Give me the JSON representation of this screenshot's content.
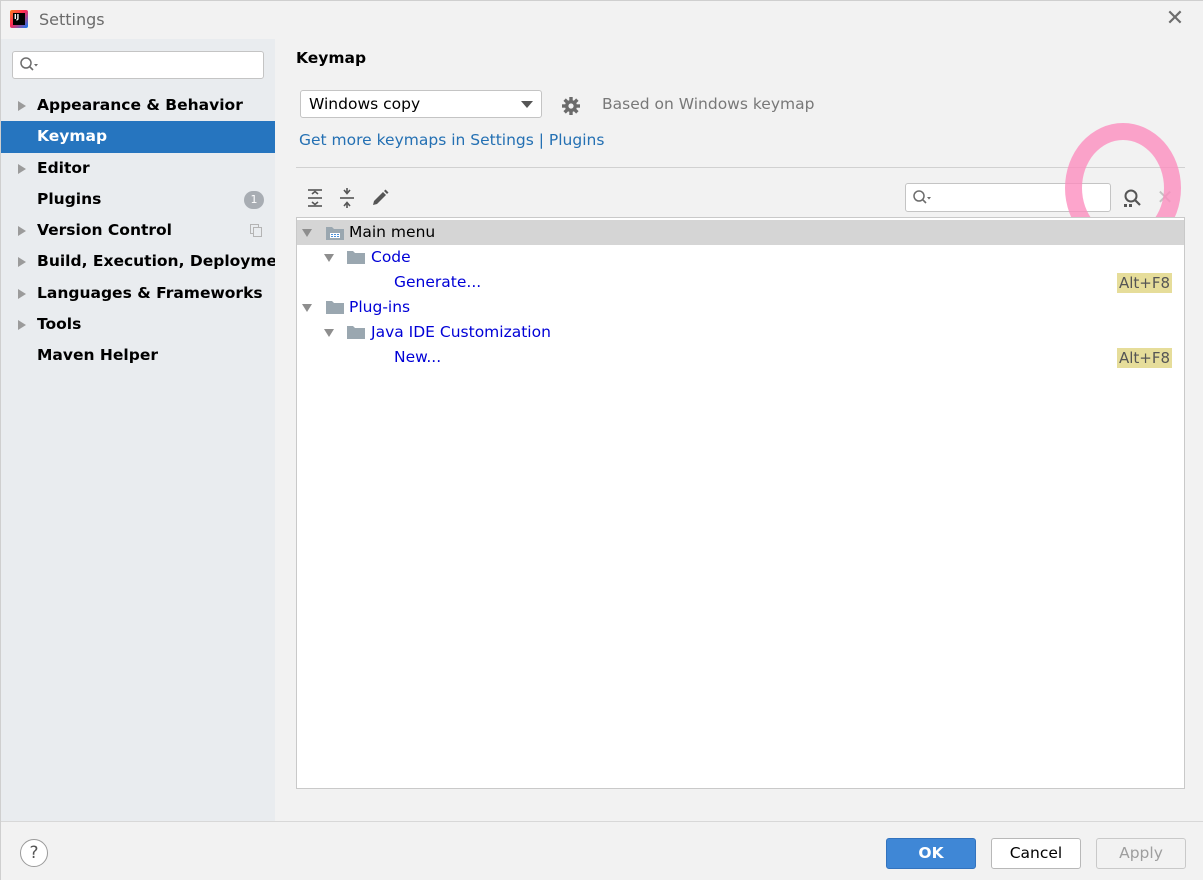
{
  "window": {
    "title": "Settings"
  },
  "sidebar": {
    "search": {
      "value": "",
      "placeholder": ""
    },
    "items": [
      {
        "label": "Appearance & Behavior",
        "expandable": true
      },
      {
        "label": "Keymap",
        "expandable": false,
        "selected": true
      },
      {
        "label": "Editor",
        "expandable": true
      },
      {
        "label": "Plugins",
        "expandable": false,
        "badge": "1"
      },
      {
        "label": "Version Control",
        "expandable": true,
        "copy_icon": "copy-icon"
      },
      {
        "label": "Build, Execution, Deployment",
        "expandable": true
      },
      {
        "label": "Languages & Frameworks",
        "expandable": true
      },
      {
        "label": "Tools",
        "expandable": true
      },
      {
        "label": "Maven Helper",
        "expandable": false
      }
    ]
  },
  "keymap": {
    "heading": "Keymap",
    "selected_keymap": "Windows copy",
    "based_on": "Based on Windows keymap",
    "links_text": "Get more keymaps in Settings | Plugins",
    "filter": {
      "value": "",
      "placeholder": ""
    },
    "tree": [
      {
        "label": "Main menu",
        "level": 0,
        "expanded": true,
        "highlighted": true,
        "shortcut": "",
        "blue": false,
        "icon": "main-menu-icon"
      },
      {
        "label": "Code",
        "level": 1,
        "expanded": true,
        "highlighted": false,
        "shortcut": "",
        "blue": true,
        "icon": "folder-icon"
      },
      {
        "label": "Generate...",
        "level": 2,
        "expanded": null,
        "highlighted": false,
        "shortcut": "Alt+F8",
        "blue": true,
        "icon": ""
      },
      {
        "label": "Plug-ins",
        "level": 0,
        "expanded": true,
        "highlighted": false,
        "shortcut": "",
        "blue": true,
        "icon": "folder-icon"
      },
      {
        "label": "Java IDE Customization",
        "level": 1,
        "expanded": true,
        "highlighted": false,
        "shortcut": "",
        "blue": true,
        "icon": "folder-icon"
      },
      {
        "label": "New...",
        "level": 2,
        "expanded": null,
        "highlighted": false,
        "shortcut": "Alt+F8",
        "blue": true,
        "icon": ""
      }
    ]
  },
  "footer": {
    "help": "?",
    "ok": "OK",
    "cancel": "Cancel",
    "apply": "Apply"
  },
  "colors": {
    "selection": "#2675bf",
    "link": "#2470b3",
    "tree_blue": "#0000d6",
    "shortcut_bg": "#e6dd9a",
    "ok_button": "#3f87d6",
    "annotation_circle": "#fc8cbe"
  }
}
